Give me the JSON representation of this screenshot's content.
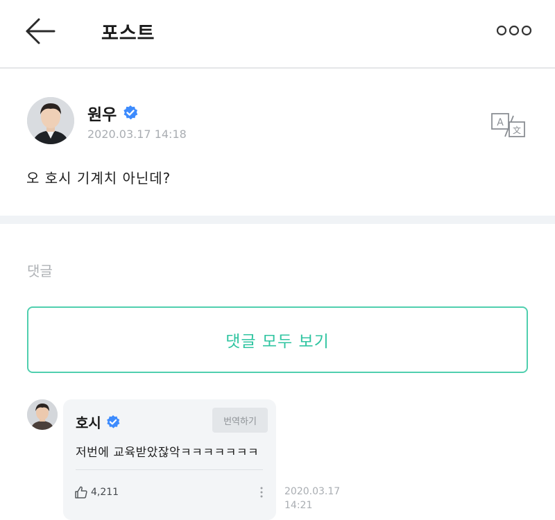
{
  "header": {
    "title": "포스트",
    "back_icon": "arrow-left-icon",
    "more_icon": "more-dots-icon"
  },
  "post": {
    "author": "원우",
    "verified_icon": "verified-badge-icon",
    "timestamp": "2020.03.17 14:18",
    "translate_icon": "translate-icon",
    "text": "오 호시 기계치 아닌데?"
  },
  "comments": {
    "label": "댓글",
    "view_all_label": "댓글 모두 보기",
    "items": [
      {
        "author": "호시",
        "translate_label": "번역하기",
        "text": "저번에 교육받았잖악ㅋㅋㅋㅋㅋㅋㅋ",
        "likes": "4,211",
        "time_date": "2020.03.17",
        "time_clock": "14:21"
      }
    ]
  },
  "colors": {
    "accent": "#2ec4a0",
    "accent_border": "#4fcfae",
    "verified": "#3d8bfd",
    "muted_text": "#a9adb2",
    "bubble_bg": "#f3f5f7"
  }
}
